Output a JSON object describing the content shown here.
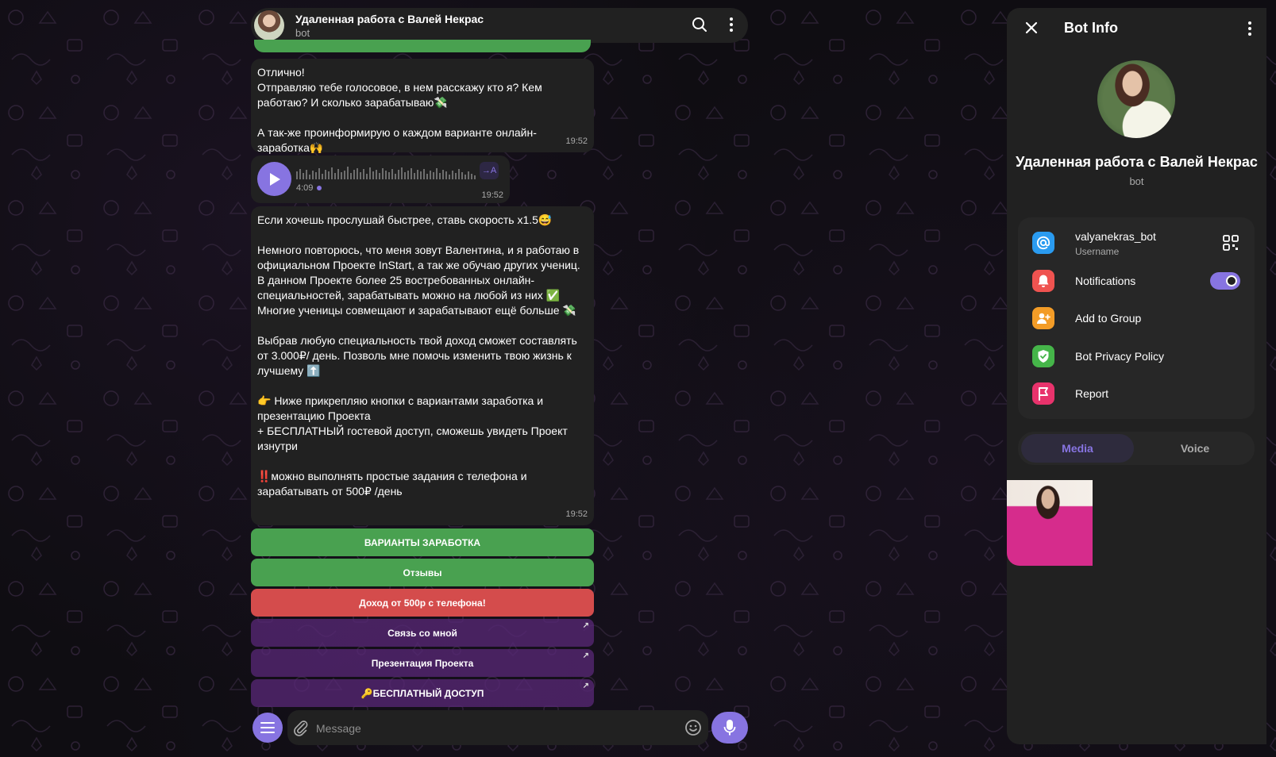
{
  "chat": {
    "title": "Удаленная работа с Валей Некрас",
    "subtitle": "bot"
  },
  "messages": [
    {
      "text": "Отлично!\nОтправляю тебе голосовое, в нем расскажу кто я? Кем работаю? И сколько зарабатываю💸\n\nА так-же проинформирую о каждом варианте онлайн-заработка🙌",
      "time": "19:52"
    },
    {
      "text": "Если хочешь прослушай быстрее, ставь скорость х1.5😅\n\nНемного повторюсь, что меня зовут Валентина, и я работаю в официальном Проекте InStart, а так же обучаю других учениц. В данном Проекте более 25 востребованных онлайн-специальностей, зарабатывать можно на любой из них ✅\nМногие ученицы совмещают и зарабатывают ещё больше 💸\n\nВыбрав любую специальность твой доход сможет составлять от 3.000₽/ день. Позволь мне помочь изменить твою жизнь к лучшему ⬆️\n\n👉 Ниже прикрепляю кнопки с вариантами заработка и презентацию Проекта\n+ БЕСПЛАТНЫЙ гостевой доступ, сможешь увидеть Проект изнутри\n\n‼️можно выполнять простые задания с телефона и зарабатывать от 500₽ /день",
      "time": "19:52"
    }
  ],
  "voice": {
    "duration": "4:09",
    "time": "19:52",
    "transcribe_label": "→A"
  },
  "keyboard": [
    {
      "label": "ВАРИАНТЫ ЗАРАБОТКА",
      "color": "#49a150",
      "link": false
    },
    {
      "label": "Отзывы",
      "color": "#49a150",
      "link": false
    },
    {
      "label": "Доход от 500р с телефона!",
      "color": "#d44c4c",
      "link": false
    },
    {
      "label": "Связь со мной",
      "color": "#5a2878",
      "link": true
    },
    {
      "label": "Презентация Проекта",
      "color": "#5a2878",
      "link": true
    },
    {
      "label": "🔑БЕСПЛАТНЫЙ ДОСТУП",
      "color": "#5a2878",
      "link": true
    }
  ],
  "input": {
    "placeholder": "Message"
  },
  "panel": {
    "title": "Bot Info",
    "name": "Удаленная работа с Валей Некрас",
    "subtitle": "bot",
    "username": "valyanekras_bot",
    "username_label": "Username",
    "notifications_label": "Notifications",
    "notifications_on": true,
    "add_to_group_label": "Add to Group",
    "privacy_label": "Bot Privacy Policy",
    "report_label": "Report",
    "tabs": [
      "Media",
      "Voice"
    ],
    "active_tab": "Media"
  },
  "colors": {
    "accent": "#8774e1",
    "username_icon": "#2a9bf0",
    "notifications_icon": "#ef5350",
    "add_group_icon": "#f39c27",
    "privacy_icon": "#45b549",
    "report_icon": "#e8336c"
  }
}
